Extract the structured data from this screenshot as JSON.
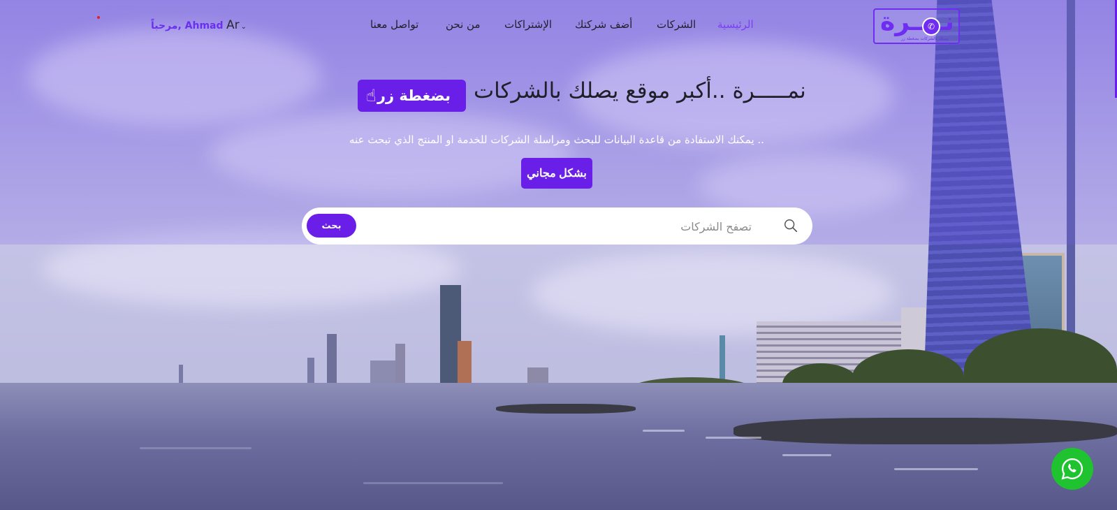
{
  "brand": {
    "logo_text": "نـمـرة",
    "logo_tagline": "يصلك بالشركات بضغطة زر",
    "accent_color": "#6a1fe8",
    "whatsapp_color": "#1fc22f"
  },
  "header": {
    "nav": [
      {
        "label": "الرئيسية",
        "active": true
      },
      {
        "label": "الشركات",
        "active": false
      },
      {
        "label": "أضف شركتك",
        "active": false
      },
      {
        "label": "الإشتراكات",
        "active": false
      },
      {
        "label": "من نحن",
        "active": false
      },
      {
        "label": "تواصل معنا",
        "active": false
      }
    ],
    "language": "Ar",
    "welcome": "مرحباً, Ahmad"
  },
  "hero": {
    "title": "نمـــــرة ..أكبر موقع يصلك بالشركات",
    "badge_label": "بضغطة زر",
    "badge_icon": "pointing-hand-icon",
    "subtitle": "يمكنك الاستفادة من قاعدة البيانات للبحث ومراسلة الشركات للخدمة او المنتج الذي تبحث عنه ..",
    "free_label": "بشكل مجاني"
  },
  "search": {
    "placeholder": "تصفح الشركات",
    "value": "",
    "button_label": "بحث",
    "icon": "search-icon"
  },
  "floating": {
    "whatsapp_icon": "whatsapp-icon"
  }
}
